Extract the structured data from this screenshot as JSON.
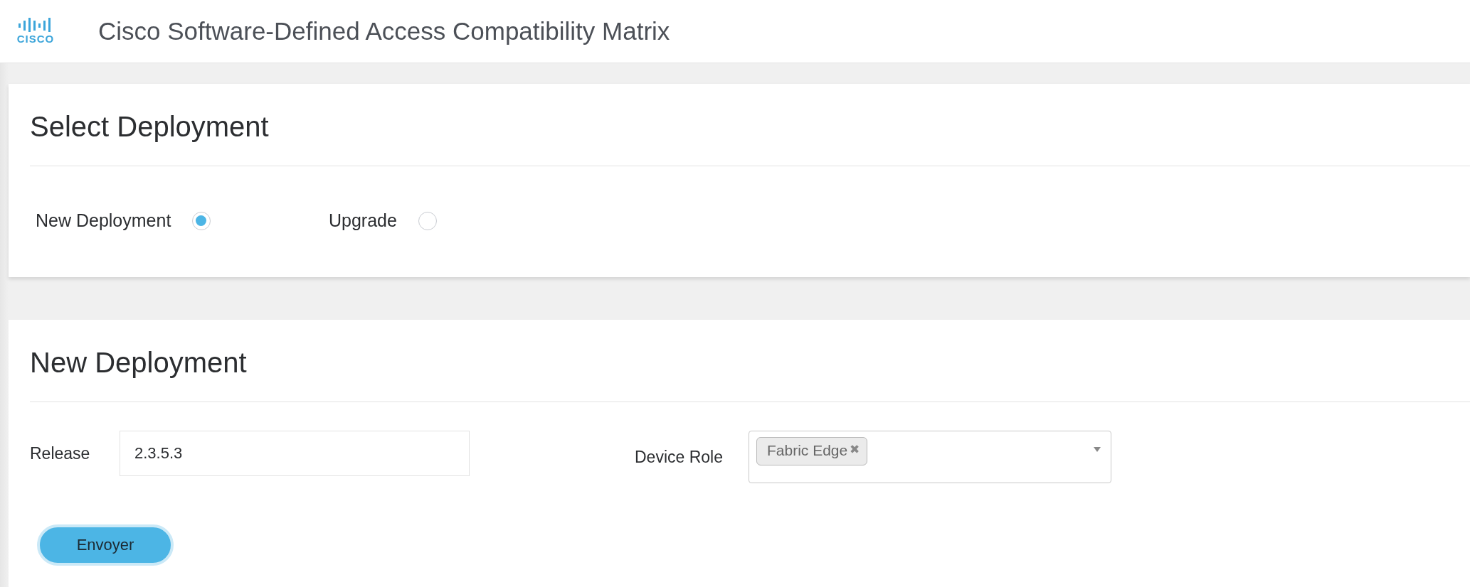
{
  "header": {
    "logo_text": "CISCO",
    "title": "Cisco Software-Defined Access Compatibility Matrix"
  },
  "select_deployment": {
    "heading": "Select Deployment",
    "options": [
      {
        "label": "New Deployment",
        "selected": true
      },
      {
        "label": "Upgrade",
        "selected": false
      }
    ]
  },
  "new_deployment": {
    "heading": "New Deployment",
    "release": {
      "label": "Release",
      "value": "2.3.5.3"
    },
    "device_role": {
      "label": "Device Role",
      "tags": [
        {
          "label": "Fabric Edge",
          "remove": "✖"
        }
      ]
    },
    "submit": "Envoyer"
  }
}
